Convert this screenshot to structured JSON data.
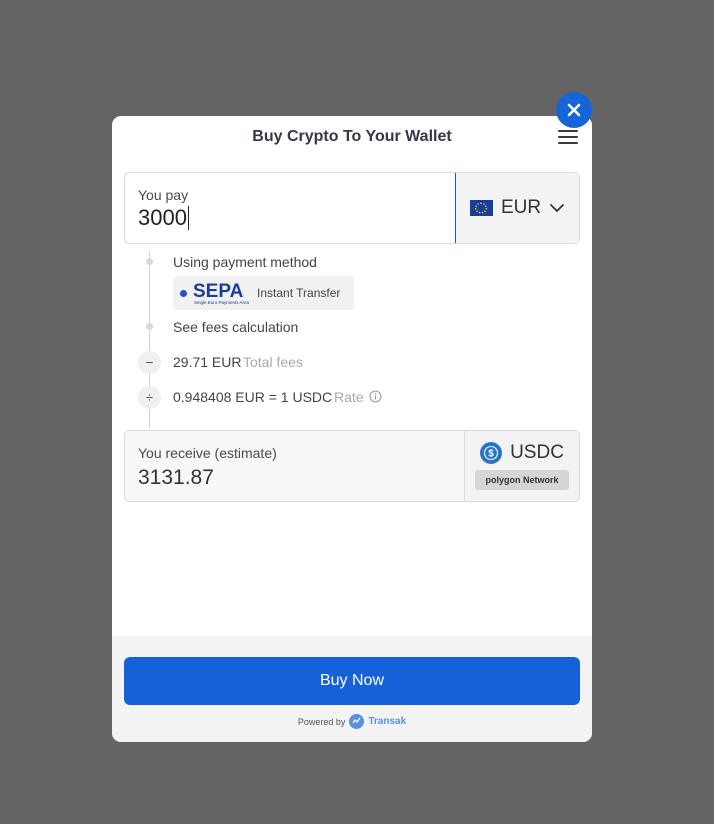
{
  "header": {
    "title": "Buy Crypto To Your Wallet",
    "menu_icon": "hamburger-menu-icon",
    "close_icon": "close-icon"
  },
  "pay": {
    "label": "You pay",
    "value": "3000",
    "currency": "EUR",
    "flag_icon": "eu-flag-icon",
    "dropdown_icon": "chevron-down-icon"
  },
  "payment": {
    "using_label": "Using payment method",
    "method_logo_text": "SEPA",
    "method_logo_subtext": "Single Euro Payments Area",
    "method_label": "Instant Transfer",
    "fees_link": "See fees calculation"
  },
  "fees": {
    "minus_symbol": "−",
    "total_value": "29.71 EUR",
    "total_label": "Total fees",
    "divide_symbol": "÷",
    "rate_value": "0.948408 EUR = 1 USDC",
    "rate_label": "Rate"
  },
  "receive": {
    "label": "You receive (estimate)",
    "value": "3131.87",
    "currency": "USDC",
    "network": "polygon Network"
  },
  "footer": {
    "buy_label": "Buy Now",
    "powered_by": "Powered by",
    "brand": "Transak"
  },
  "colors": {
    "accent": "#1661d8",
    "backdrop": "#646464"
  }
}
